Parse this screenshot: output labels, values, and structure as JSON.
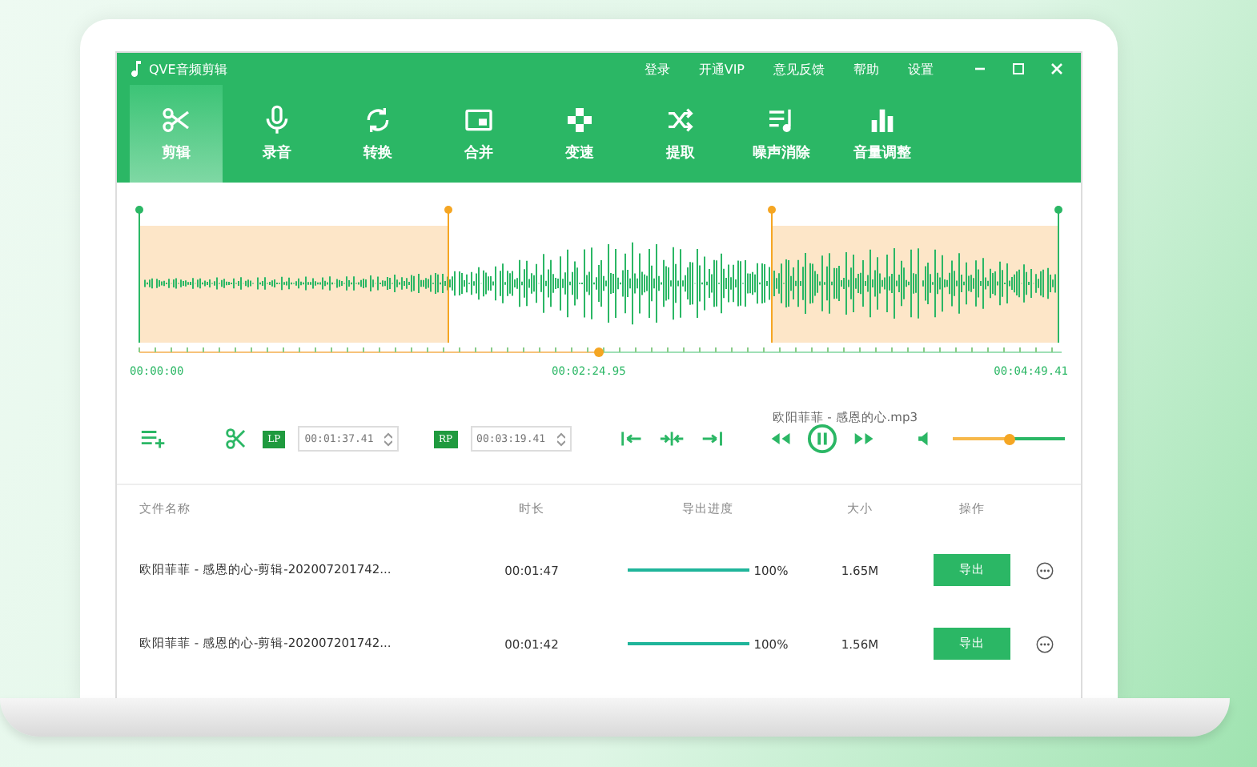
{
  "app": {
    "title": "QVE音频剪辑",
    "menu": [
      "登录",
      "开通VIP",
      "意见反馈",
      "帮助",
      "设置"
    ]
  },
  "tabs": [
    {
      "label": "剪辑",
      "selected": true
    },
    {
      "label": "录音",
      "selected": false
    },
    {
      "label": "转换",
      "selected": false
    },
    {
      "label": "合并",
      "selected": false
    },
    {
      "label": "变速",
      "selected": false
    },
    {
      "label": "提取",
      "selected": false
    },
    {
      "label": "噪声消除",
      "selected": false
    },
    {
      "label": "音量调整",
      "selected": false
    }
  ],
  "timeline": {
    "start": "00:00:00",
    "current": "00:02:24.95",
    "end": "00:04:49.41"
  },
  "player": {
    "filename": "欧阳菲菲 - 感恩的心.mp3",
    "points": [
      {
        "badge": "LP",
        "value": "00:01:37.41"
      },
      {
        "badge": "RP",
        "value": "00:03:19.41"
      }
    ],
    "playing": true,
    "volume": {
      "level": 0.5
    }
  },
  "table": {
    "columns": [
      "文件名称",
      "时长",
      "导出进度",
      "大小",
      "操作"
    ],
    "rows": [
      {
        "name": "欧阳菲菲 - 感恩的心-剪辑-202007201742...",
        "duration": "00:01:47",
        "progress": {
          "level": 1
        },
        "percent": "100%",
        "size": "1.65M",
        "action": "导出"
      },
      {
        "name": "欧阳菲菲 - 感恩的心-剪辑-202007201742...",
        "duration": "00:01:42",
        "progress": {
          "level": 1
        },
        "percent": "100%",
        "size": "1.56M",
        "action": "导出"
      }
    ]
  }
}
